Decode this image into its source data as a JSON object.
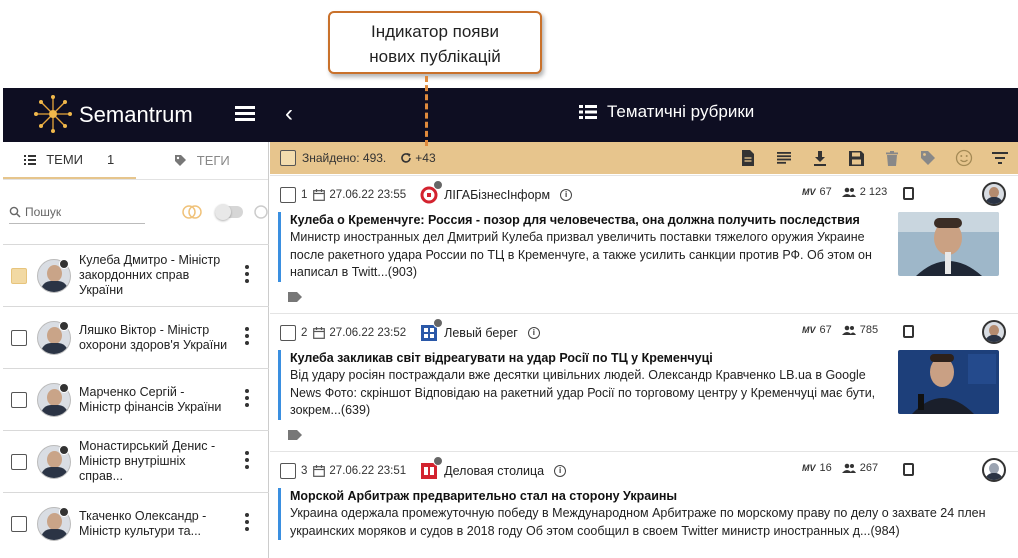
{
  "callout": {
    "line1": "Індикатор появи",
    "line2": "нових публікацій"
  },
  "header": {
    "logo_text": "Semantrum",
    "center_title": "Тематичні рубрики"
  },
  "left_tabs": {
    "topics_label": "ТЕМИ",
    "topics_count": "1",
    "tags_label": "ТЕГИ"
  },
  "search": {
    "placeholder": "Пошук"
  },
  "people": [
    {
      "name": "Кулеба Дмитро - Міністр закордонних справ України",
      "checked": true
    },
    {
      "name": "Ляшко Віктор - Міністр охорони здоров'я України",
      "checked": false
    },
    {
      "name": "Марченко Сергій - Міністр фінансів України",
      "checked": false
    },
    {
      "name": "Монастирський Денис - Міністр внутрішніх справ...",
      "checked": false
    },
    {
      "name": "Ткаченко Олександр - Міністр культури та...",
      "checked": false
    }
  ],
  "toolbar": {
    "found": "Знайдено: 493.",
    "new_count": "+43"
  },
  "articles": [
    {
      "num": "1",
      "date": "27.06.22 23:55",
      "source": "ЛІГАБізнесІнформ",
      "mv": "67",
      "audience": "2 123",
      "title": "Кулеба о Кременчуге: Россия - позор для человечества, она должна получить последствия",
      "text": "Министр иностранных дел Дмитрий Кулеба призвал увеличить поставки тяжелого оружия Украине после ракетного удара России по ТЦ в Кременчуге, а также усилить санкции против РФ. Об этом он написал в Twitt...(903)"
    },
    {
      "num": "2",
      "date": "27.06.22 23:52",
      "source": "Левый берег",
      "mv": "67",
      "audience": "785",
      "title": "Кулеба закликав світ відреагувати на удар Росії по ТЦ у Кременчуці",
      "text": "Від удару росіян постраждали вже десятки цивільних людей. Олександр Кравченко LB.ua в Google News Фото: скріншот Відповідаю на ракетний удар Росії по торговому центру у Кременчуці має бути, зокрем...(639)"
    },
    {
      "num": "3",
      "date": "27.06.22 23:51",
      "source": "Деловая столица",
      "mv": "16",
      "audience": "267",
      "title": "Морской Арбитраж предварительно стал на сторону Украины",
      "text": "Украина одержала промежуточную победу в Международном Арбитраже по морскому праву по делу о захвате 24 плен украинских моряков и судов в 2018 году Об этом сообщил в своем Twitter министр иностранных д...(984)"
    }
  ],
  "colors": {
    "header_bg": "#0e0e22",
    "toolbar_bg": "#e7c58d",
    "accent_blue": "#3a8fe0",
    "callout_border": "#c9712b"
  }
}
